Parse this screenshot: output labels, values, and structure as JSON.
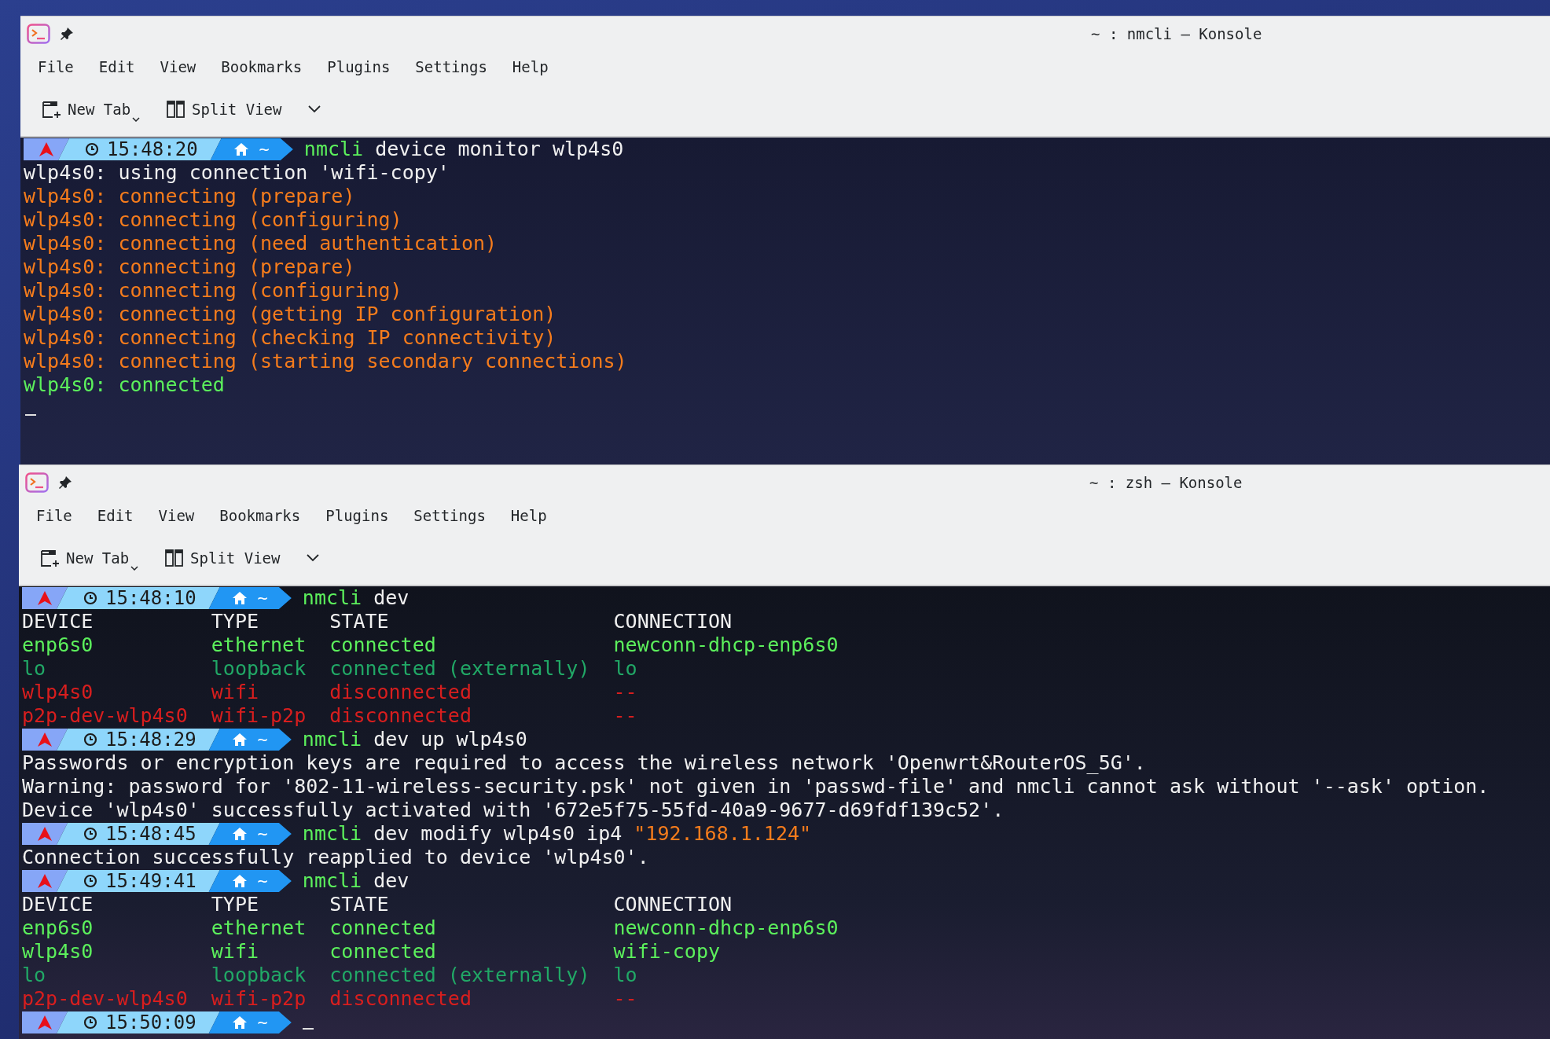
{
  "windows": [
    {
      "title": "~ : nmcli — Konsole",
      "menu": [
        "File",
        "Edit",
        "View",
        "Bookmarks",
        "Plugins",
        "Settings",
        "Help"
      ],
      "toolbar": [
        {
          "kind": "newtab",
          "label": "New Tab"
        },
        {
          "kind": "split",
          "label": "Split View"
        }
      ],
      "lines": [
        {
          "kind": "prompt",
          "time": "15:48:20",
          "dir": "~",
          "segments": [
            {
              "text": "nmcli",
              "color": "#5cf05c"
            },
            {
              "text": " device monitor wlp4s0",
              "color": "#f0f0f0"
            }
          ]
        },
        {
          "kind": "output",
          "segments": [
            {
              "text": "wlp4s0: using connection 'wifi-copy'",
              "color": "#f0f0f0"
            }
          ]
        },
        {
          "kind": "output",
          "segments": [
            {
              "text": "wlp4s0: connecting (prepare)",
              "color": "#f67c1c"
            }
          ]
        },
        {
          "kind": "output",
          "segments": [
            {
              "text": "wlp4s0: connecting (configuring)",
              "color": "#f67c1c"
            }
          ]
        },
        {
          "kind": "output",
          "segments": [
            {
              "text": "wlp4s0: connecting (need authentication)",
              "color": "#f67c1c"
            }
          ]
        },
        {
          "kind": "output",
          "segments": [
            {
              "text": "wlp4s0: connecting (prepare)",
              "color": "#f67c1c"
            }
          ]
        },
        {
          "kind": "output",
          "segments": [
            {
              "text": "wlp4s0: connecting (configuring)",
              "color": "#f67c1c"
            }
          ]
        },
        {
          "kind": "output",
          "segments": [
            {
              "text": "wlp4s0: connecting (getting IP configuration)",
              "color": "#f67c1c"
            }
          ]
        },
        {
          "kind": "output",
          "segments": [
            {
              "text": "wlp4s0: connecting (checking IP connectivity)",
              "color": "#f67c1c"
            }
          ]
        },
        {
          "kind": "output",
          "segments": [
            {
              "text": "wlp4s0: connecting (starting secondary connections)",
              "color": "#f67c1c"
            }
          ]
        },
        {
          "kind": "output",
          "segments": [
            {
              "text": "wlp4s0: connected",
              "color": "#5cf05c"
            }
          ]
        },
        {
          "kind": "cursor"
        }
      ]
    },
    {
      "title": "~ : zsh — Konsole",
      "menu": [
        "File",
        "Edit",
        "View",
        "Bookmarks",
        "Plugins",
        "Settings",
        "Help"
      ],
      "toolbar": [
        {
          "kind": "newtab",
          "label": "New Tab"
        },
        {
          "kind": "split",
          "label": "Split View"
        }
      ],
      "lines": [
        {
          "kind": "prompt",
          "time": "15:48:10",
          "dir": "~",
          "segments": [
            {
              "text": "nmcli",
              "color": "#5cf05c"
            },
            {
              "text": " dev",
              "color": "#f0f0f0"
            }
          ]
        },
        {
          "kind": "row",
          "cells": [
            {
              "text": "DEVICE",
              "color": "#f0f0f0"
            },
            {
              "text": "TYPE",
              "color": "#f0f0f0"
            },
            {
              "text": "STATE",
              "color": "#f0f0f0"
            },
            {
              "text": "CONNECTION",
              "color": "#f0f0f0"
            }
          ]
        },
        {
          "kind": "row",
          "cells": [
            {
              "text": "enp6s0",
              "color": "#5cf05c"
            },
            {
              "text": "ethernet",
              "color": "#5cf05c"
            },
            {
              "text": "connected",
              "color": "#5cf05c"
            },
            {
              "text": "newconn-dhcp-enp6s0",
              "color": "#5cf05c"
            }
          ]
        },
        {
          "kind": "row",
          "cells": [
            {
              "text": "lo",
              "color": "#21a866"
            },
            {
              "text": "loopback",
              "color": "#21a866"
            },
            {
              "text": "connected (externally)",
              "color": "#21a866"
            },
            {
              "text": "lo",
              "color": "#21a866"
            }
          ]
        },
        {
          "kind": "row",
          "cells": [
            {
              "text": "wlp4s0",
              "color": "#d81e1e"
            },
            {
              "text": "wifi",
              "color": "#d81e1e"
            },
            {
              "text": "disconnected",
              "color": "#d81e1e"
            },
            {
              "text": "--",
              "color": "#d81e1e"
            }
          ]
        },
        {
          "kind": "row",
          "cells": [
            {
              "text": "p2p-dev-wlp4s0",
              "color": "#d81e1e"
            },
            {
              "text": "wifi-p2p",
              "color": "#d81e1e"
            },
            {
              "text": "disconnected",
              "color": "#d81e1e"
            },
            {
              "text": "--",
              "color": "#d81e1e"
            }
          ]
        },
        {
          "kind": "prompt",
          "time": "15:48:29",
          "dir": "~",
          "segments": [
            {
              "text": "nmcli",
              "color": "#5cf05c"
            },
            {
              "text": " dev up wlp4s0",
              "color": "#f0f0f0"
            }
          ]
        },
        {
          "kind": "output",
          "segments": [
            {
              "text": "Passwords or encryption keys are required to access the wireless network 'Openwrt&RouterOS_5G'.",
              "color": "#f0f0f0"
            }
          ]
        },
        {
          "kind": "output",
          "segments": [
            {
              "text": "Warning: password for '802-11-wireless-security.psk' not given in 'passwd-file' and nmcli cannot ask without '--ask' option.",
              "color": "#f0f0f0"
            }
          ]
        },
        {
          "kind": "output",
          "segments": [
            {
              "text": "Device 'wlp4s0' successfully activated with '672e5f75-55fd-40a9-9677-d69fdf139c52'.",
              "color": "#f0f0f0"
            }
          ]
        },
        {
          "kind": "prompt",
          "time": "15:48:45",
          "dir": "~",
          "segments": [
            {
              "text": "nmcli",
              "color": "#5cf05c"
            },
            {
              "text": " dev modify wlp4s0 ip4 ",
              "color": "#f0f0f0"
            },
            {
              "text": "\"192.168.1.124\"",
              "color": "#f67c1c"
            }
          ]
        },
        {
          "kind": "output",
          "segments": [
            {
              "text": "Connection successfully reapplied to device 'wlp4s0'.",
              "color": "#f0f0f0"
            }
          ]
        },
        {
          "kind": "prompt",
          "time": "15:49:41",
          "dir": "~",
          "segments": [
            {
              "text": "nmcli",
              "color": "#5cf05c"
            },
            {
              "text": " dev",
              "color": "#f0f0f0"
            }
          ]
        },
        {
          "kind": "row",
          "cells": [
            {
              "text": "DEVICE",
              "color": "#f0f0f0"
            },
            {
              "text": "TYPE",
              "color": "#f0f0f0"
            },
            {
              "text": "STATE",
              "color": "#f0f0f0"
            },
            {
              "text": "CONNECTION",
              "color": "#f0f0f0"
            }
          ]
        },
        {
          "kind": "row",
          "cells": [
            {
              "text": "enp6s0",
              "color": "#5cf05c"
            },
            {
              "text": "ethernet",
              "color": "#5cf05c"
            },
            {
              "text": "connected",
              "color": "#5cf05c"
            },
            {
              "text": "newconn-dhcp-enp6s0",
              "color": "#5cf05c"
            }
          ]
        },
        {
          "kind": "row",
          "cells": [
            {
              "text": "wlp4s0",
              "color": "#5cf05c"
            },
            {
              "text": "wifi",
              "color": "#5cf05c"
            },
            {
              "text": "connected",
              "color": "#5cf05c"
            },
            {
              "text": "wifi-copy",
              "color": "#5cf05c"
            }
          ]
        },
        {
          "kind": "row",
          "cells": [
            {
              "text": "lo",
              "color": "#21a866"
            },
            {
              "text": "loopback",
              "color": "#21a866"
            },
            {
              "text": "connected (externally)",
              "color": "#21a866"
            },
            {
              "text": "lo",
              "color": "#21a866"
            }
          ]
        },
        {
          "kind": "row",
          "cells": [
            {
              "text": "p2p-dev-wlp4s0",
              "color": "#d81e1e"
            },
            {
              "text": "wifi-p2p",
              "color": "#d81e1e"
            },
            {
              "text": "disconnected",
              "color": "#d81e1e"
            },
            {
              "text": "--",
              "color": "#d81e1e"
            }
          ]
        },
        {
          "kind": "prompt",
          "time": "15:50:09",
          "dir": "~",
          "cursor": true
        }
      ]
    }
  ]
}
